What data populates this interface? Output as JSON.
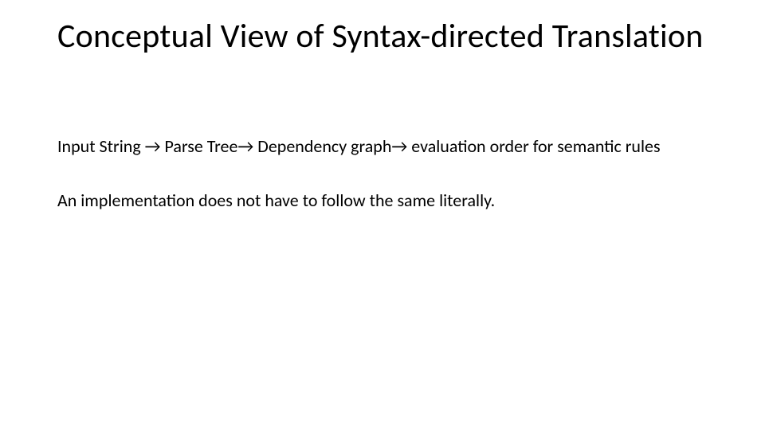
{
  "slide": {
    "title": "Conceptual View of Syntax-directed Translation",
    "paragraph1": "Input String → Parse Tree→ Dependency graph→ evaluation order for semantic rules",
    "paragraph2": "An implementation does not have to follow the same literally."
  }
}
